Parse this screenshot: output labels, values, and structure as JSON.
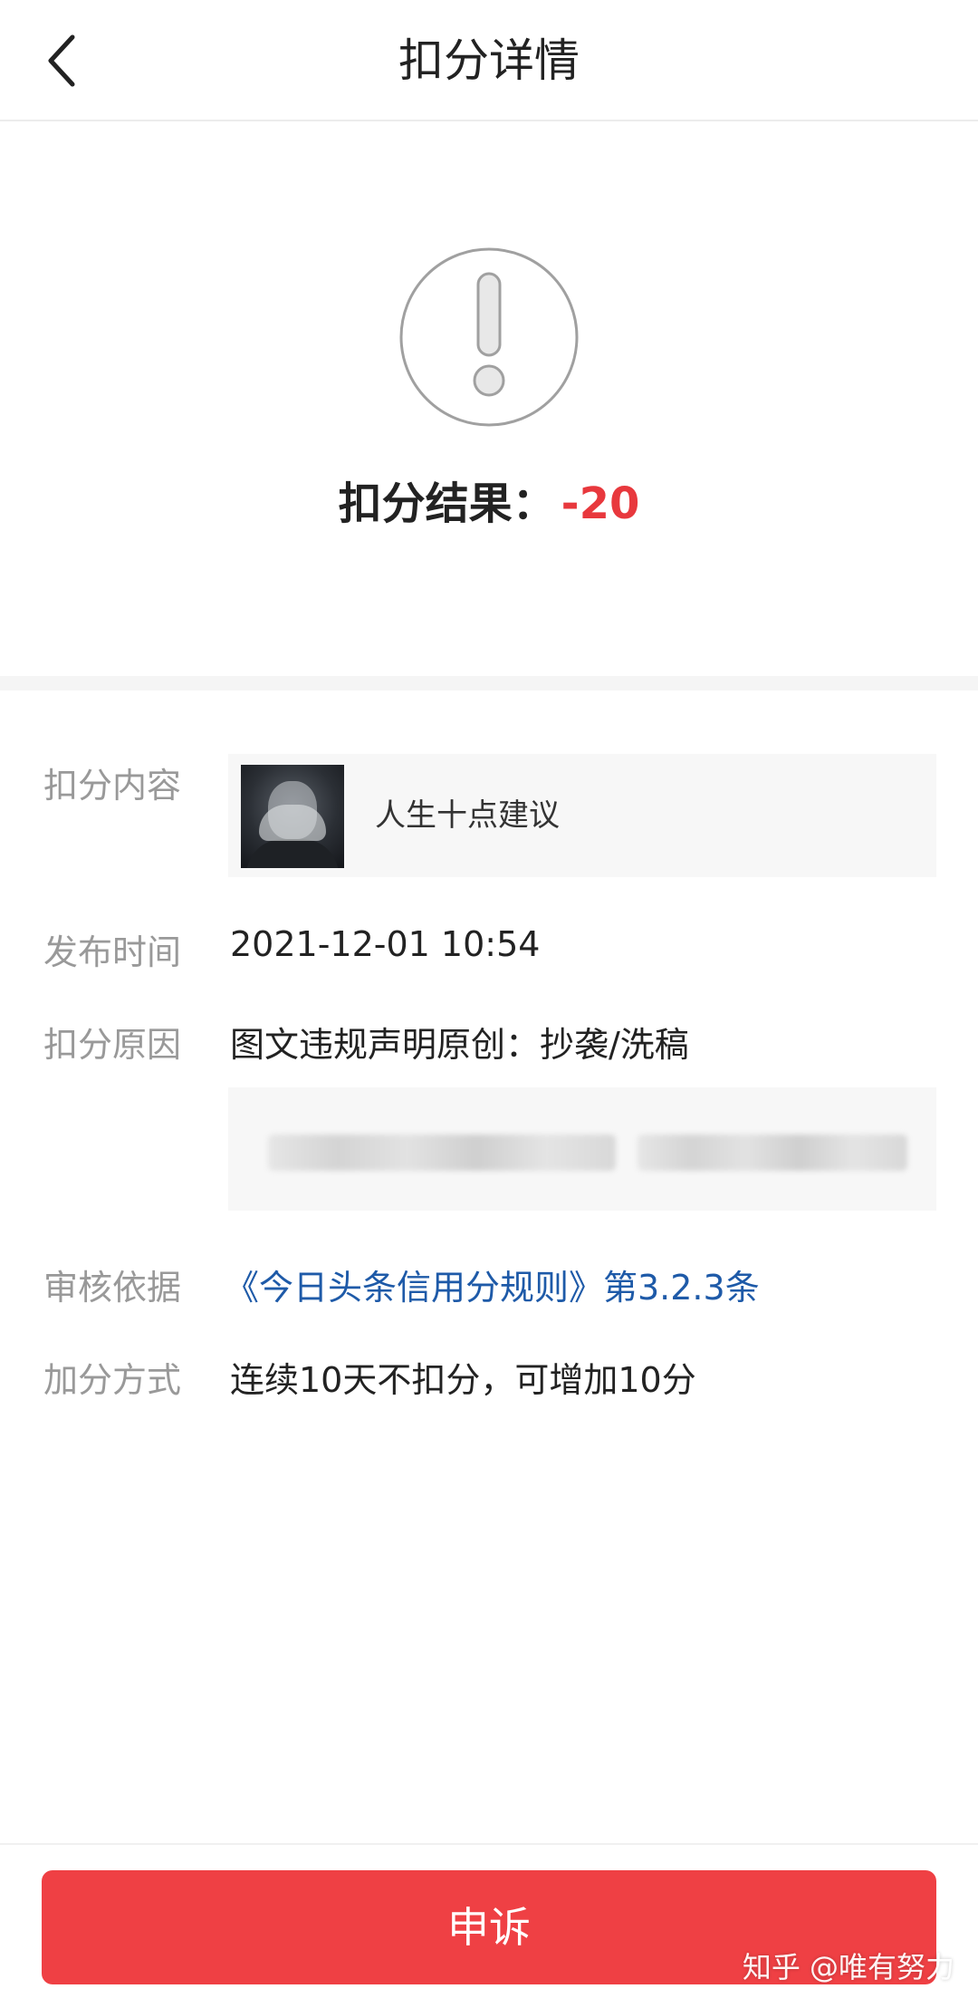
{
  "header": {
    "title": "扣分详情"
  },
  "result": {
    "label": "扣分结果：",
    "value": "-20"
  },
  "details": {
    "content": {
      "label": "扣分内容",
      "title": "人生十点建议"
    },
    "publish_time": {
      "label": "发布时间",
      "value": "2021-12-01 10:54"
    },
    "reason": {
      "label": "扣分原因",
      "value": "图文违规声明原创：抄袭/洗稿"
    },
    "basis": {
      "label": "审核依据",
      "value": "《今日头条信用分规则》第3.2.3条"
    },
    "bonus": {
      "label": "加分方式",
      "value": "连续10天不扣分，可增加10分"
    }
  },
  "actions": {
    "appeal_label": "申诉"
  },
  "watermark": "知乎 @唯有努力",
  "colors": {
    "accent_red": "#ef4044",
    "link_blue": "#1e5aa8",
    "label_gray": "#999999"
  },
  "icons": {
    "back": "chevron-left-icon",
    "warning": "exclamation-circle-icon"
  }
}
